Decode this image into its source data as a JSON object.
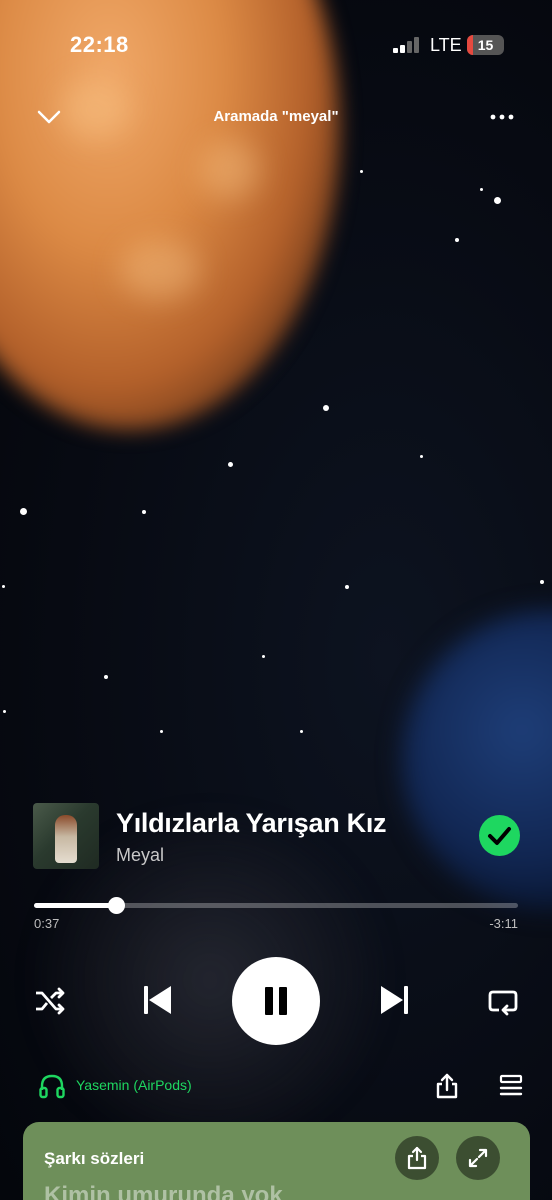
{
  "status_bar": {
    "time": "22:18",
    "network": "LTE",
    "battery": "15",
    "battery_color": "#e5493f"
  },
  "header": {
    "context_title": "Aramada \"meyal\""
  },
  "track": {
    "title": "Yıldızlarla Yarışan Kız",
    "artist": "Meyal",
    "added_to_library": true,
    "accent": "#1ed760"
  },
  "progress": {
    "elapsed": "0:37",
    "remaining": "-3:11",
    "fraction": 0.17
  },
  "controls": {
    "shuffle_icon": "shuffle-icon",
    "previous_icon": "skip-previous-icon",
    "state": "playing",
    "next_icon": "skip-next-icon",
    "repeat_icon": "repeat-icon"
  },
  "device": {
    "label": "Yasemin (AirPods)",
    "icon": "headphones-icon"
  },
  "lyrics": {
    "heading": "Şarkı sözleri",
    "first_line": "Kimin umurunda yok",
    "card_color": "#6e8f5a"
  }
}
